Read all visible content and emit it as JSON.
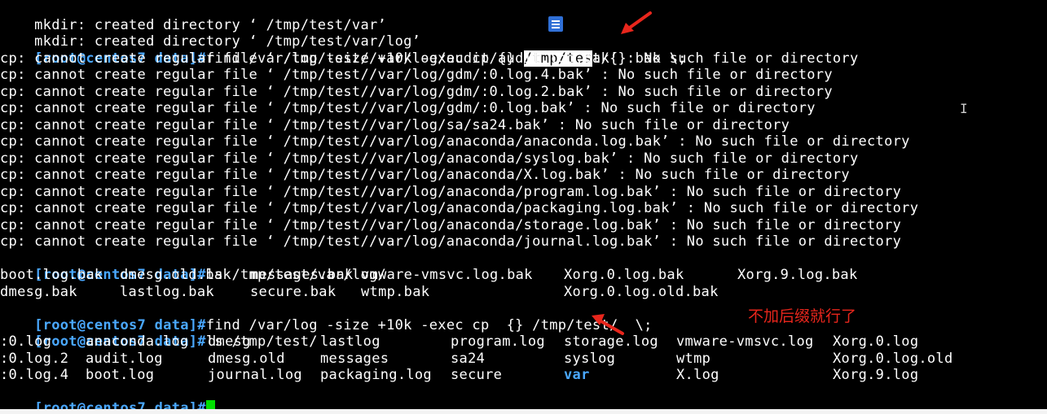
{
  "terminal": {
    "prompt": "[root@centos7 data]#",
    "mkdir_lines": [
      "mkdir: created directory ‘ /tmp/test/var’",
      "mkdir: created directory ‘ /tmp/test/var/log’"
    ],
    "cmd1": {
      "pre": "find /var/log -size +10k -exec cp {} ",
      "selected": "/tmp/tes",
      "post": "t/{}.bak \\;"
    },
    "cp_errors": [
      "cp: cannot create regular file ‘ /tmp/test//var/log/audit/audit.log.bak’ : No such file or directory",
      "cp: cannot create regular file ‘ /tmp/test//var/log/gdm/:0.log.4.bak’ : No such file or directory",
      "cp: cannot create regular file ‘ /tmp/test//var/log/gdm/:0.log.2.bak’ : No such file or directory",
      "cp: cannot create regular file ‘ /tmp/test//var/log/gdm/:0.log.bak’ : No such file or directory",
      "cp: cannot create regular file ‘ /tmp/test//var/log/sa/sa24.bak’ : No such file or directory",
      "cp: cannot create regular file ‘ /tmp/test//var/log/anaconda/anaconda.log.bak’ : No such file or directory",
      "cp: cannot create regular file ‘ /tmp/test//var/log/anaconda/syslog.bak’ : No such file or directory",
      "cp: cannot create regular file ‘ /tmp/test//var/log/anaconda/X.log.bak’ : No such file or directory",
      "cp: cannot create regular file ‘ /tmp/test//var/log/anaconda/program.log.bak’ : No such file or directory",
      "cp: cannot create regular file ‘ /tmp/test//var/log/anaconda/packaging.log.bak’ : No such file or directory",
      "cp: cannot create regular file ‘ /tmp/test//var/log/anaconda/storage.log.bak’ : No such file or directory",
      "cp: cannot create regular file ‘ /tmp/test//var/log/anaconda/journal.log.bak’ : No such file or directory"
    ],
    "cmd2": "ls /tmp/test/var/log/",
    "ls1_rows": [
      [
        "boot.log.bak",
        "dmesg.old.bak",
        "messages.bak",
        "vmware-vmsvc.log.bak",
        "Xorg.0.log.bak",
        "Xorg.9.log.bak"
      ],
      [
        "dmesg.bak",
        "lastlog.bak",
        "secure.bak",
        "wtmp.bak",
        "Xorg.0.log.old.bak",
        ""
      ]
    ],
    "cmd3": "find /var/log -size +10k -exec cp  {} /tmp/test/  \\;",
    "cmd4": "ls /tmp/test/",
    "ls2_rows": [
      [
        ":0.log",
        "anaconda.log",
        "dmesg",
        "lastlog",
        "program.log",
        "storage.log",
        "vmware-vmsvc.log",
        "Xorg.0.log"
      ],
      [
        ":0.log.2",
        "audit.log",
        "dmesg.old",
        "messages",
        "sa24",
        "syslog",
        "wtmp",
        "Xorg.0.log.old"
      ],
      [
        ":0.log.4",
        "boot.log",
        "journal.log",
        "packaging.log",
        "secure",
        "var",
        "X.log",
        "Xorg.9.log"
      ]
    ],
    "directory_entry": "var"
  },
  "annotation": {
    "text": "不加后缀就行了",
    "color": "#e8261c"
  },
  "colors": {
    "background": "#000000",
    "text": "#ffffff",
    "prompt": "#4aa8ff",
    "cursor": "#00e000"
  },
  "icons": [
    "document-icon",
    "text-cursor-icon",
    "red-arrow-icon"
  ]
}
